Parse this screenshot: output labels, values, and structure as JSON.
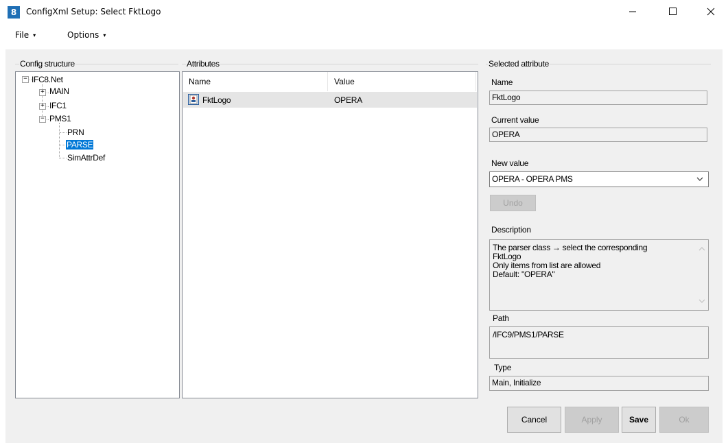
{
  "window": {
    "title": "ConfigXml Setup: Select FktLogo",
    "icon_text": "8",
    "controls": {
      "minimize": "—",
      "maximize": "☐",
      "close": "✕"
    }
  },
  "menu": [
    {
      "label": "File",
      "caret": "▾"
    },
    {
      "label": "Options",
      "caret": "▾"
    }
  ],
  "config_structure": {
    "title": "Config structure",
    "nodes": [
      {
        "label": "IFC8.Net",
        "expander": "−"
      },
      {
        "label": "MAIN",
        "expander": "+"
      },
      {
        "label": "IFC1",
        "expander": "+"
      },
      {
        "label": "PMS1",
        "expander": "−"
      },
      {
        "label": "PRN"
      },
      {
        "label": "PARSE",
        "selected": true
      },
      {
        "label": "SimAttrDef"
      }
    ]
  },
  "attributes": {
    "title": "Attributes",
    "columns": [
      "Name",
      "Value"
    ],
    "rows": [
      {
        "name": "FktLogo",
        "value": "OPERA",
        "icon": "attribute-icon"
      }
    ]
  },
  "selected_attribute": {
    "title": "Selected attribute",
    "name_label": "Name",
    "name_value": "FktLogo",
    "current_label": "Current value",
    "current_value": "OPERA",
    "new_label": "New value",
    "new_value": "OPERA - OPERA PMS",
    "undo_label": "Undo",
    "description_label": "Description",
    "description_lines": [
      "The parser class → select the corresponding",
      "FktLogo",
      "Only items from list are allowed",
      "Default: \"OPERA\""
    ],
    "path_label": "Path",
    "path_value": "/IFC9/PMS1/PARSE",
    "type_label": "Type",
    "type_value": "Main, Initialize"
  },
  "buttons": {
    "cancel": "Cancel",
    "apply": "Apply",
    "save": "Save",
    "ok": "Ok"
  },
  "colors": {
    "selection": "#0078d7",
    "row_highlight": "#e5e5e5",
    "window_bg": "#f0f0f0"
  }
}
